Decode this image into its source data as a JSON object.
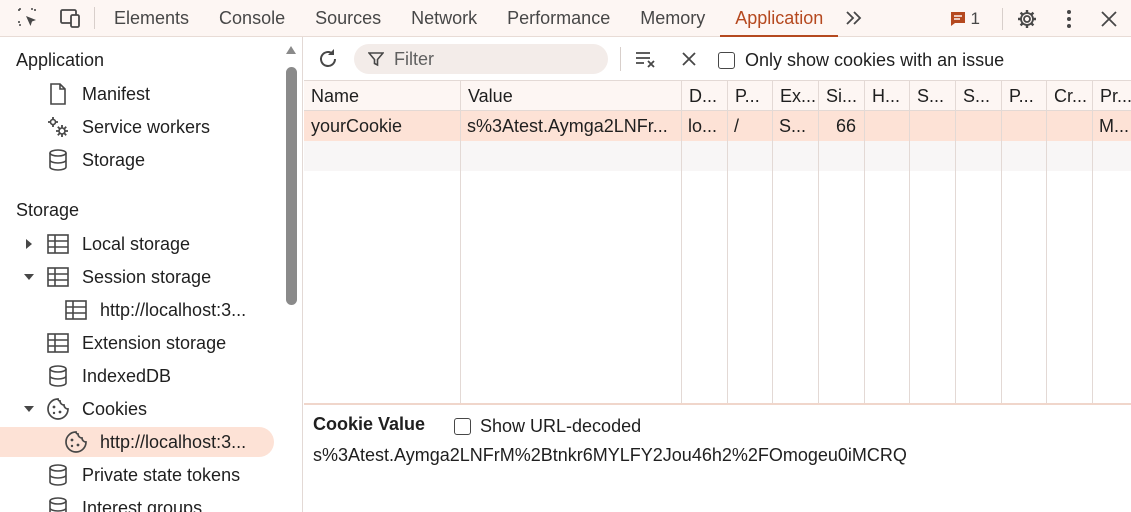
{
  "topbar": {
    "tabs": [
      "Elements",
      "Console",
      "Sources",
      "Network",
      "Performance",
      "Memory",
      "Application"
    ],
    "active_tab": "Application",
    "issues_count": "1"
  },
  "sidebar": {
    "application_title": "Application",
    "application_items": [
      "Manifest",
      "Service workers",
      "Storage"
    ],
    "storage_title": "Storage",
    "storage_items": {
      "local_storage": "Local storage",
      "session_storage": "Session storage",
      "session_origin": "http://localhost:3...",
      "extension_storage": "Extension storage",
      "indexeddb": "IndexedDB",
      "cookies": "Cookies",
      "cookies_origin": "http://localhost:3...",
      "private_state_tokens": "Private state tokens",
      "interest_groups": "Interest groups"
    }
  },
  "toolbar": {
    "filter_placeholder": "Filter",
    "only_issue_label": "Only show cookies with an issue"
  },
  "table": {
    "headers": [
      "Name",
      "Value",
      "D...",
      "P...",
      "Ex...",
      "Si...",
      "H...",
      "S...",
      "S...",
      "P...",
      "Cr...",
      "Pr..."
    ],
    "rows": [
      [
        "yourCookie",
        "s%3Atest.Aymga2LNFr...",
        "lo...",
        "/",
        "S...",
        "66",
        "",
        "",
        "",
        "",
        "",
        "M..."
      ]
    ]
  },
  "cookie_value": {
    "title": "Cookie Value",
    "show_decoded_label": "Show URL-decoded",
    "value": "s%3Atest.Aymga2LNFrM%2Btnkr6MYLFY2Jou46h2%2FOmogeu0iMCRQ"
  },
  "colors": {
    "accent": "#b5491f",
    "selection": "#fde2d6"
  }
}
